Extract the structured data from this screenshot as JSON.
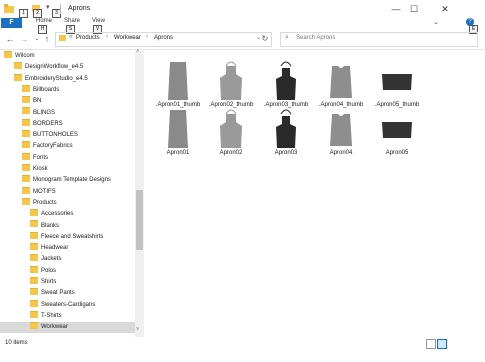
{
  "window": {
    "title": "Aprons",
    "minimize": "—",
    "maximize": "☐",
    "close": "✕"
  },
  "ribbon": {
    "file": "F",
    "file_keytip": "",
    "tabs": [
      {
        "label": "Home",
        "keytip": "H"
      },
      {
        "label": "Share",
        "keytip": "S"
      },
      {
        "label": "View",
        "keytip": "V"
      }
    ],
    "qa_keytips": [
      "1",
      "2",
      "3"
    ],
    "help_keytip": "E"
  },
  "address": {
    "path": [
      "Products",
      "Workwear",
      "Aprons"
    ],
    "search_placeholder": "Search Aprons"
  },
  "tree": [
    {
      "label": "Wilcom",
      "indent": 0,
      "selected": false
    },
    {
      "label": "DesignWorkflow_e4.5",
      "indent": 1,
      "selected": false
    },
    {
      "label": "EmbroideryStudio_e4.5",
      "indent": 1,
      "selected": false
    },
    {
      "label": "Billboards",
      "indent": 2,
      "selected": false
    },
    {
      "label": "BN",
      "indent": 2,
      "selected": false
    },
    {
      "label": "BLINGS",
      "indent": 2,
      "selected": false
    },
    {
      "label": "BORDERS",
      "indent": 2,
      "selected": false
    },
    {
      "label": "BUTTONHOLES",
      "indent": 2,
      "selected": false
    },
    {
      "label": "FactoryFabrics",
      "indent": 2,
      "selected": false
    },
    {
      "label": "Fonts",
      "indent": 2,
      "selected": false
    },
    {
      "label": "Kiosk",
      "indent": 2,
      "selected": false
    },
    {
      "label": "Monogram Template Designs",
      "indent": 2,
      "selected": false
    },
    {
      "label": "MOTIFS",
      "indent": 2,
      "selected": false
    },
    {
      "label": "Products",
      "indent": 2,
      "selected": false
    },
    {
      "label": "Accessories",
      "indent": 3,
      "selected": false
    },
    {
      "label": "Blanks",
      "indent": 3,
      "selected": false
    },
    {
      "label": "Fleece and Sweatshirts",
      "indent": 3,
      "selected": false
    },
    {
      "label": "Headwear",
      "indent": 3,
      "selected": false
    },
    {
      "label": "Jackets",
      "indent": 3,
      "selected": false
    },
    {
      "label": "Polos",
      "indent": 3,
      "selected": false
    },
    {
      "label": "Shirts",
      "indent": 3,
      "selected": false
    },
    {
      "label": "Sweat Pants",
      "indent": 3,
      "selected": false
    },
    {
      "label": "Sweaters-Cardigans",
      "indent": 3,
      "selected": false
    },
    {
      "label": "T-Shirts",
      "indent": 3,
      "selected": false
    },
    {
      "label": "Workwear",
      "indent": 3,
      "selected": true
    }
  ],
  "files": [
    {
      "label": ".Apron01_thumb",
      "kind": "long"
    },
    {
      "label": ".Apron02_thumb",
      "kind": "bib-light"
    },
    {
      "label": ".Apron03_thumb",
      "kind": "bib-dark"
    },
    {
      "label": ".Apron04_thumb",
      "kind": "tabard"
    },
    {
      "label": ".Apron05_thumb",
      "kind": "waist"
    },
    {
      "label": "Apron01",
      "kind": "long"
    },
    {
      "label": "Apron02",
      "kind": "bib-light"
    },
    {
      "label": "Apron03",
      "kind": "bib-dark"
    },
    {
      "label": "Apron04",
      "kind": "tabard"
    },
    {
      "label": "Apron05",
      "kind": "waist"
    }
  ],
  "status": {
    "count": "10 items"
  },
  "colors": {
    "accent": "#1a6fc4",
    "folder": "#f5c64a",
    "selection": "#d9d9d9"
  }
}
